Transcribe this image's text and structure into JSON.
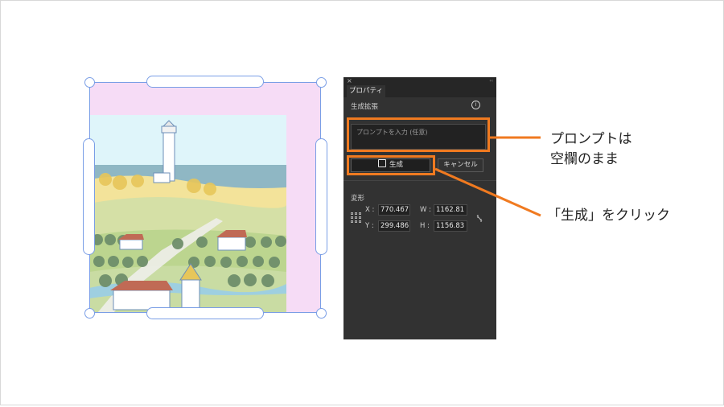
{
  "panel": {
    "close_glyph": "×",
    "collapse_glyph": "‹‹",
    "tab_label": "プロパティ",
    "section_title": "生成拡張",
    "info_glyph": "i",
    "prompt_placeholder": "プロンプトを入力 (任意)",
    "generate_label": "生成",
    "cancel_label": "キャンセル",
    "transform_title": "変形",
    "x_label": "X :",
    "x_value": "770.467",
    "y_label": "Y :",
    "y_value": "299.486",
    "w_label": "W :",
    "w_value": "1162.81",
    "h_label": "H :",
    "h_value": "1156.83"
  },
  "annotations": {
    "callout_prompt_line1": "プロンプトは",
    "callout_prompt_line2": "空欄のまま",
    "callout_generate": "「生成」をクリック"
  },
  "colors": {
    "highlight": "#f07a20",
    "selection": "#7a9ee6",
    "expand_area": "#f6dcf6",
    "panel_bg": "#323232"
  }
}
